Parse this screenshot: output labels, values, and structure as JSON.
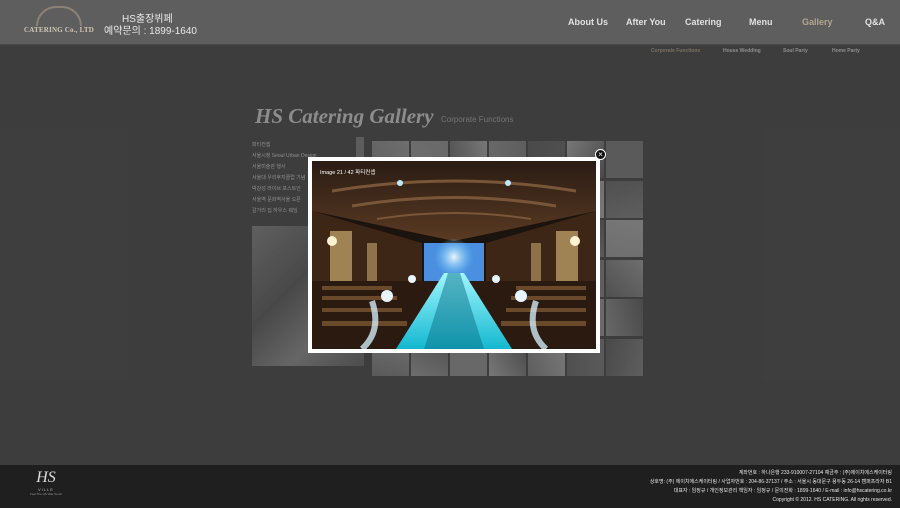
{
  "header": {
    "logo_text": "CATERING Co., LTD",
    "brand_line1": "HS출장뷔페",
    "brand_line2": "예약문의 : 1899-1640",
    "nav": [
      {
        "label": "About Us",
        "active": false
      },
      {
        "label": "After You",
        "active": false
      },
      {
        "label": "Catering",
        "active": false
      },
      {
        "label": "Menu",
        "active": false
      },
      {
        "label": "Gallery",
        "active": true
      },
      {
        "label": "Q&A",
        "active": false
      }
    ],
    "subnav": [
      {
        "label": "Corporate Functions",
        "active": true
      },
      {
        "label": "House Wedding",
        "active": false
      },
      {
        "label": "Soul Party",
        "active": false
      },
      {
        "label": "Home Party",
        "active": false
      }
    ]
  },
  "gallery": {
    "title": "HS Catering Gallery",
    "subtitle": "Corporate Functions",
    "list": [
      "파티컨셉",
      "서울시청 Seoul Urban Design",
      "서울미술관 행사",
      "서울대 우리후지클럽 기념",
      "박강성 라이브 포스트인",
      "서울역 문화역서울 오픈",
      "갈거리 집 하우스 웨딩"
    ]
  },
  "lightbox": {
    "caption": "Image 21 / 42   파티컨셉",
    "close_label": "×"
  },
  "footer": {
    "logo_main": "HS",
    "logo_sub": "VILLE",
    "logo_tag": "Feel The HS Ville Touch",
    "line1": "계좌번호 : 하나은행 233-910007-27104  예금주 : (주)에이치에스케이터링",
    "line2": "상호명: (주) 에이치에스케이터링 / 사업자번호 : 204-86-37137 / 주소 : 서울시 동대문구 용두동 26-14 캠퍼프라자 B1",
    "line3": "대표자 : 임정규 / 개인정보관리 책임자 : 임정규 / 문의전화 : 1899-1640  / E-mail : info@hscatering.co.kr",
    "line4": "Copyright © 2012. HS CATERING. All rights reserved."
  },
  "colors": {
    "background": "#5b5b5b",
    "accent_active": "#b3a48f",
    "footer": "#1f1f1f",
    "aisle_glow": "#3fd9e6"
  }
}
